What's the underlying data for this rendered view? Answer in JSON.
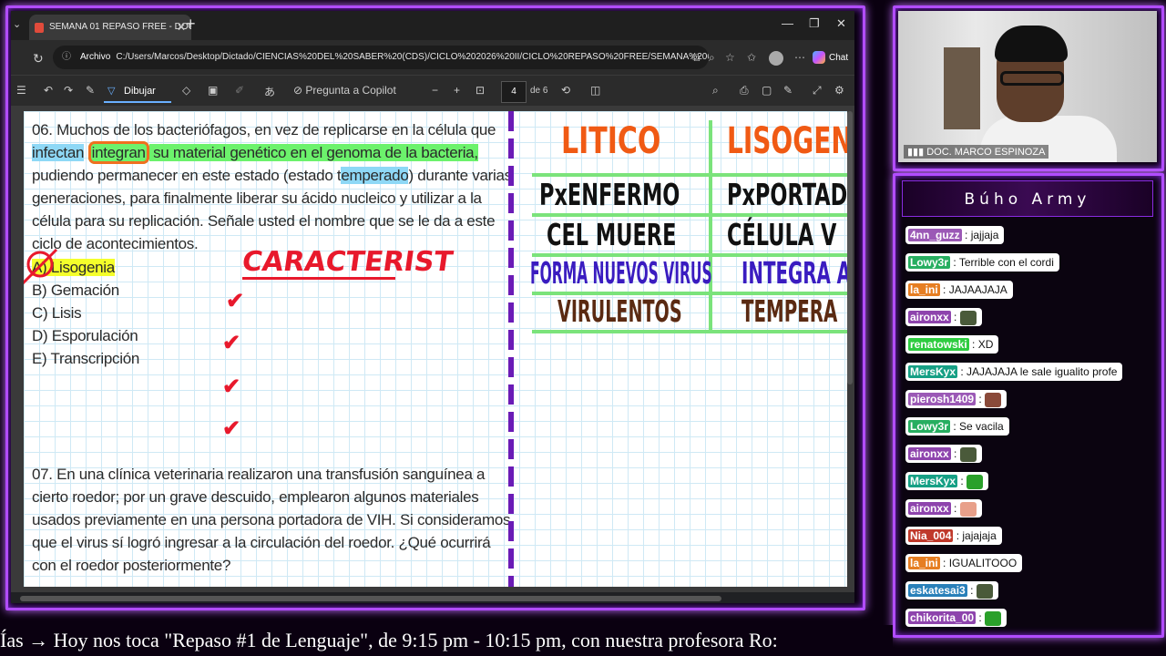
{
  "browser": {
    "tab_title": "SEMANA 01 REPASO FREE - DOC",
    "url_scheme": "Archivo",
    "url": "C:/Users/Marcos/Desktop/Dictado/CIENCIAS%20DEL%20SABER%20(CDS)/CICLO%202026%20II/CICLO%20REPASO%20FREE/SEMANA%2001%20REP...",
    "chat_label": "Chat"
  },
  "pdf_toolbar": {
    "draw_label": "Dibujar",
    "copilot_label": "Pregunta a Copilot",
    "page_current": "4",
    "page_total": "de 6"
  },
  "question6": {
    "line1": "06. Muchos de los bacteriófagos, en vez de replicarse en la célula que",
    "l2_a": "infectan",
    "l2_b": "integran",
    "l2_c": " su material genético en el genoma de la bacteria,",
    "l3_a": "pudiendo permanecer en este estado (estado t",
    "l3_b": "emperado",
    "l3_c": ") durante varias",
    "line4": "generaciones, para finalmente liberar su ácido nucleico y utilizar a la",
    "line5": "célula para su replicación. Señale usted el nombre que se le da a este",
    "line6": "ciclo de acontecimientos.",
    "options": [
      "A) Lisogenia",
      "B) Gemación",
      "C) Lisis",
      "D) Esporulación",
      "E) Transcripción"
    ]
  },
  "question7": {
    "line1": "07. En una clínica veterinaria realizaron una transfusión sanguínea a",
    "line2": "cierto roedor; por un grave descuido, emplearon algunos materiales",
    "line3": "usados previamente en una persona portadora de VIH. Si consideramos",
    "line4": "que el virus sí logró ingresar a la circulación del roedor. ¿Qué ocurrirá",
    "line5": "con el roedor posteriormente?"
  },
  "annotations": {
    "caracterist": "CARACTERIST",
    "col1_title": "LITICO",
    "col2_title": "LISOGENI",
    "col1": [
      "PxENFERMO",
      "CEL MUERE",
      "FORMA NUEVOS VIRUS",
      "VIRULENTOS"
    ],
    "col2": [
      "PxPORTAD",
      "CÉLULA V",
      "INTEGRA A",
      "TEMPERA"
    ]
  },
  "camera": {
    "name": "DOC. MARCO ESPINOZA"
  },
  "chat": {
    "title": "Búho Army",
    "messages": [
      {
        "user": "4nn_guzz",
        "text": "jajjaja",
        "color": "#9b59b6"
      },
      {
        "user": "Lowy3r",
        "text": "Terrible con el cordi",
        "color": "#27ae60"
      },
      {
        "user": "la_ini",
        "text": "JAJAAJAJA",
        "color": "#e67e22"
      },
      {
        "user": "aironxx",
        "text": "",
        "color": "#8e44ad",
        "emote": true
      },
      {
        "user": "renatowski",
        "text": "XD",
        "color": "#2ecc40"
      },
      {
        "user": "MersKyx",
        "text": "JAJAJAJA le sale igualito profe",
        "color": "#16a085"
      },
      {
        "user": "pierosh1409",
        "text": "",
        "color": "#9b59b6",
        "emote": true
      },
      {
        "user": "Lowy3r",
        "text": "Se vacila",
        "color": "#27ae60"
      },
      {
        "user": "aironxx",
        "text": "",
        "color": "#8e44ad",
        "emote": true
      },
      {
        "user": "MersKyx",
        "text": "",
        "color": "#16a085",
        "emote": true
      },
      {
        "user": "aironxx",
        "text": "",
        "color": "#8e44ad",
        "emote": true
      },
      {
        "user": "Nia_004",
        "text": "jajajaja",
        "color": "#c0392b"
      },
      {
        "user": "la_ini",
        "text": "IGUALITOOO",
        "color": "#e67e22"
      },
      {
        "user": "eskatesai3",
        "text": "",
        "color": "#2980b9",
        "emote": true
      },
      {
        "user": "chikorita_00",
        "text": "",
        "color": "#8e44ad",
        "emote": true
      }
    ]
  },
  "ticker": {
    "text": "Ías  →  Hoy nos toca \"Repaso #1 de Lenguaje\", de 9:15 pm - 10:15 pm, con nuestra profesora Ro:"
  }
}
